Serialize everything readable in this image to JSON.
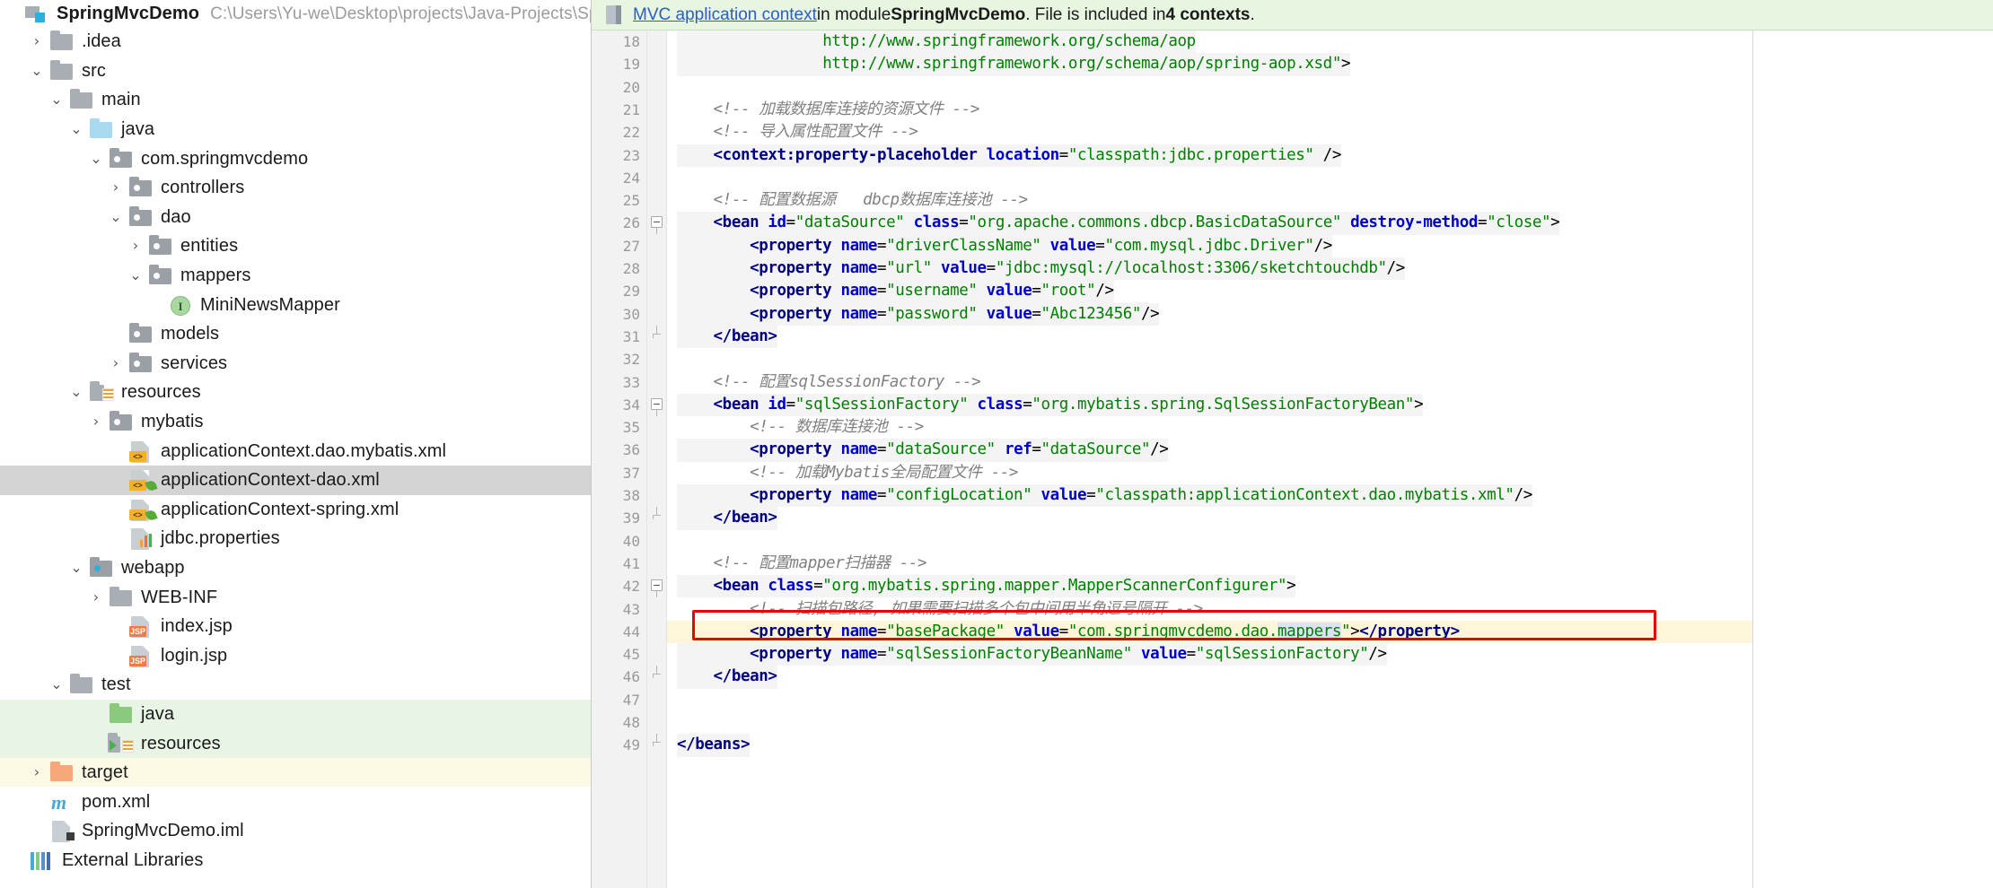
{
  "project": {
    "title": "SpringMvcDemo",
    "path": "C:\\Users\\Yu-we\\Desktop\\projects\\Java-Projects\\Sprin",
    "tree": [
      {
        "label": ".idea",
        "indent": 1,
        "arrow": "right",
        "icon": "folder-gray",
        "bg": ""
      },
      {
        "label": "src",
        "indent": 1,
        "arrow": "down",
        "icon": "folder-gray",
        "bg": ""
      },
      {
        "label": "main",
        "indent": 2,
        "arrow": "down",
        "icon": "folder-gray",
        "bg": ""
      },
      {
        "label": "java",
        "indent": 3,
        "arrow": "down",
        "icon": "folder-blue",
        "bg": ""
      },
      {
        "label": "com.springmvcdemo",
        "indent": 4,
        "arrow": "down",
        "icon": "package",
        "bg": ""
      },
      {
        "label": "controllers",
        "indent": 5,
        "arrow": "right",
        "icon": "package",
        "bg": ""
      },
      {
        "label": "dao",
        "indent": 5,
        "arrow": "down",
        "icon": "package",
        "bg": ""
      },
      {
        "label": "entities",
        "indent": 6,
        "arrow": "right",
        "icon": "package",
        "bg": ""
      },
      {
        "label": "mappers",
        "indent": 6,
        "arrow": "down",
        "icon": "package",
        "bg": ""
      },
      {
        "label": "MiniNewsMapper",
        "indent": 7,
        "arrow": "none",
        "icon": "interface",
        "bg": ""
      },
      {
        "label": "models",
        "indent": 5,
        "arrow": "none",
        "icon": "package",
        "bg": ""
      },
      {
        "label": "services",
        "indent": 5,
        "arrow": "right",
        "icon": "package",
        "bg": ""
      },
      {
        "label": "resources",
        "indent": 3,
        "arrow": "down",
        "icon": "resource",
        "bg": ""
      },
      {
        "label": "mybatis",
        "indent": 4,
        "arrow": "right",
        "icon": "package",
        "bg": ""
      },
      {
        "label": "applicationContext.dao.mybatis.xml",
        "indent": 5,
        "arrow": "none",
        "icon": "xml-file",
        "bg": ""
      },
      {
        "label": "applicationContext-dao.xml",
        "indent": 5,
        "arrow": "none",
        "icon": "xml-spring",
        "bg": "selected"
      },
      {
        "label": "applicationContext-spring.xml",
        "indent": 5,
        "arrow": "none",
        "icon": "xml-spring",
        "bg": ""
      },
      {
        "label": "jdbc.properties",
        "indent": 5,
        "arrow": "none",
        "icon": "properties",
        "bg": ""
      },
      {
        "label": "webapp",
        "indent": 3,
        "arrow": "down",
        "icon": "folder-web",
        "bg": ""
      },
      {
        "label": "WEB-INF",
        "indent": 4,
        "arrow": "right",
        "icon": "folder-gray",
        "bg": ""
      },
      {
        "label": "index.jsp",
        "indent": 5,
        "arrow": "none",
        "icon": "jsp-file",
        "bg": ""
      },
      {
        "label": "login.jsp",
        "indent": 5,
        "arrow": "none",
        "icon": "jsp-file",
        "bg": ""
      },
      {
        "label": "test",
        "indent": 2,
        "arrow": "down",
        "icon": "folder-gray",
        "bg": ""
      },
      {
        "label": "java",
        "indent": 4,
        "arrow": "none",
        "icon": "folder-green",
        "bg": "green"
      },
      {
        "label": "resources",
        "indent": 4,
        "arrow": "none",
        "icon": "test-resource",
        "bg": "green"
      },
      {
        "label": "target",
        "indent": 1,
        "arrow": "right",
        "icon": "folder-orange",
        "bg": "yellow"
      },
      {
        "label": "pom.xml",
        "indent": 1,
        "arrow": "none",
        "icon": "maven",
        "bg": ""
      },
      {
        "label": "SpringMvcDemo.iml",
        "indent": 1,
        "arrow": "none",
        "icon": "iml",
        "bg": ""
      },
      {
        "label": "External Libraries",
        "indent": 0,
        "arrow": "none",
        "icon": "libraries",
        "bg": ""
      }
    ]
  },
  "notification": {
    "icon": "spring-context-icon",
    "link_text": "MVC application context",
    "text_1": "in module ",
    "module": "SpringMvcDemo",
    "text_2": ". File is included in ",
    "contexts": "4 contexts",
    "text_3": ".",
    "background_color": "#e8f5e0"
  },
  "editor": {
    "first_visible_line": 18,
    "caret_line": 44,
    "highlight_color": "#fdf6d8",
    "red_box_color": "#ee0000",
    "lines": [
      {
        "n": 18,
        "partial": true,
        "segs": [
          {
            "t": "                ",
            "c": "plain"
          },
          {
            "t": "http://www.springframework.org/schema/aop",
            "c": "str"
          }
        ],
        "hl": true
      },
      {
        "n": 19,
        "segs": [
          {
            "t": "                ",
            "c": "plain"
          },
          {
            "t": "http://www.springframework.org/schema/aop/spring-aop.xsd",
            "c": "str"
          },
          {
            "t": "\"",
            "c": "str"
          },
          {
            "t": ">",
            "c": "brkt"
          }
        ],
        "hl": true
      },
      {
        "n": 20,
        "segs": []
      },
      {
        "n": 21,
        "segs": [
          {
            "t": "    <!-- 加载数据库连接的资源文件 -->",
            "c": "cmt"
          }
        ]
      },
      {
        "n": 22,
        "segs": [
          {
            "t": "    <!-- 导入属性配置文件 -->",
            "c": "cmt"
          }
        ]
      },
      {
        "n": 23,
        "hl": true,
        "segs": [
          {
            "t": "    ",
            "c": "plain"
          },
          {
            "t": "<context:property-placeholder",
            "c": "tag"
          },
          {
            "t": " ",
            "c": "plain"
          },
          {
            "t": "location",
            "c": "attr"
          },
          {
            "t": "=",
            "c": "brkt"
          },
          {
            "t": "\"classpath:jdbc.properties\"",
            "c": "str"
          },
          {
            "t": " />",
            "c": "brkt"
          }
        ]
      },
      {
        "n": 24,
        "segs": []
      },
      {
        "n": 25,
        "segs": [
          {
            "t": "    <!-- 配置数据源   dbcp数据库连接池 -->",
            "c": "cmt"
          }
        ]
      },
      {
        "n": 26,
        "fold": "open",
        "hl": true,
        "segs": [
          {
            "t": "    ",
            "c": "plain"
          },
          {
            "t": "<bean",
            "c": "tag"
          },
          {
            "t": " ",
            "c": "plain"
          },
          {
            "t": "id",
            "c": "attr"
          },
          {
            "t": "=",
            "c": "brkt"
          },
          {
            "t": "\"dataSource\"",
            "c": "str"
          },
          {
            "t": " ",
            "c": "plain"
          },
          {
            "t": "class",
            "c": "attr"
          },
          {
            "t": "=",
            "c": "brkt"
          },
          {
            "t": "\"org.apache.commons.dbcp.BasicDataSource\"",
            "c": "str"
          },
          {
            "t": " ",
            "c": "plain"
          },
          {
            "t": "destroy-method",
            "c": "attr"
          },
          {
            "t": "=",
            "c": "brkt"
          },
          {
            "t": "\"close\"",
            "c": "str"
          },
          {
            "t": ">",
            "c": "brkt"
          }
        ]
      },
      {
        "n": 27,
        "hl": true,
        "segs": [
          {
            "t": "        ",
            "c": "plain"
          },
          {
            "t": "<property",
            "c": "tag"
          },
          {
            "t": " ",
            "c": "plain"
          },
          {
            "t": "name",
            "c": "attr"
          },
          {
            "t": "=",
            "c": "brkt"
          },
          {
            "t": "\"driverClassName\"",
            "c": "str"
          },
          {
            "t": " ",
            "c": "plain"
          },
          {
            "t": "value",
            "c": "attr"
          },
          {
            "t": "=",
            "c": "brkt"
          },
          {
            "t": "\"com.mysql.jdbc.Driver\"",
            "c": "str"
          },
          {
            "t": "/>",
            "c": "brkt"
          }
        ]
      },
      {
        "n": 28,
        "hl": true,
        "segs": [
          {
            "t": "        ",
            "c": "plain"
          },
          {
            "t": "<property",
            "c": "tag"
          },
          {
            "t": " ",
            "c": "plain"
          },
          {
            "t": "name",
            "c": "attr"
          },
          {
            "t": "=",
            "c": "brkt"
          },
          {
            "t": "\"url\"",
            "c": "str"
          },
          {
            "t": " ",
            "c": "plain"
          },
          {
            "t": "value",
            "c": "attr"
          },
          {
            "t": "=",
            "c": "brkt"
          },
          {
            "t": "\"jdbc:mysql://localhost:3306/sketchtouchdb\"",
            "c": "str"
          },
          {
            "t": "/>",
            "c": "brkt"
          }
        ]
      },
      {
        "n": 29,
        "hl": true,
        "segs": [
          {
            "t": "        ",
            "c": "plain"
          },
          {
            "t": "<property",
            "c": "tag"
          },
          {
            "t": " ",
            "c": "plain"
          },
          {
            "t": "name",
            "c": "attr"
          },
          {
            "t": "=",
            "c": "brkt"
          },
          {
            "t": "\"username\"",
            "c": "str"
          },
          {
            "t": " ",
            "c": "plain"
          },
          {
            "t": "value",
            "c": "attr"
          },
          {
            "t": "=",
            "c": "brkt"
          },
          {
            "t": "\"root\"",
            "c": "str"
          },
          {
            "t": "/>",
            "c": "brkt"
          }
        ]
      },
      {
        "n": 30,
        "hl": true,
        "segs": [
          {
            "t": "        ",
            "c": "plain"
          },
          {
            "t": "<property",
            "c": "tag"
          },
          {
            "t": " ",
            "c": "plain"
          },
          {
            "t": "name",
            "c": "attr"
          },
          {
            "t": "=",
            "c": "brkt"
          },
          {
            "t": "\"password\"",
            "c": "str"
          },
          {
            "t": " ",
            "c": "plain"
          },
          {
            "t": "value",
            "c": "attr"
          },
          {
            "t": "=",
            "c": "brkt"
          },
          {
            "t": "\"Abc123456\"",
            "c": "str"
          },
          {
            "t": "/>",
            "c": "brkt"
          }
        ]
      },
      {
        "n": 31,
        "fold": "close",
        "hl": true,
        "segs": [
          {
            "t": "    ",
            "c": "plain"
          },
          {
            "t": "</bean>",
            "c": "tag"
          }
        ]
      },
      {
        "n": 32,
        "segs": []
      },
      {
        "n": 33,
        "segs": [
          {
            "t": "    <!-- 配置sqlSessionFactory -->",
            "c": "cmt"
          }
        ]
      },
      {
        "n": 34,
        "fold": "open",
        "hl": true,
        "segs": [
          {
            "t": "    ",
            "c": "plain"
          },
          {
            "t": "<bean",
            "c": "tag"
          },
          {
            "t": " ",
            "c": "plain"
          },
          {
            "t": "id",
            "c": "attr"
          },
          {
            "t": "=",
            "c": "brkt"
          },
          {
            "t": "\"sqlSessionFactory\"",
            "c": "str"
          },
          {
            "t": " ",
            "c": "plain"
          },
          {
            "t": "class",
            "c": "attr"
          },
          {
            "t": "=",
            "c": "brkt"
          },
          {
            "t": "\"org.mybatis.spring.SqlSessionFactoryBean\"",
            "c": "str"
          },
          {
            "t": ">",
            "c": "brkt"
          }
        ]
      },
      {
        "n": 35,
        "segs": [
          {
            "t": "        <!-- 数据库连接池 -->",
            "c": "cmt"
          }
        ]
      },
      {
        "n": 36,
        "hl": true,
        "segs": [
          {
            "t": "        ",
            "c": "plain"
          },
          {
            "t": "<property",
            "c": "tag"
          },
          {
            "t": " ",
            "c": "plain"
          },
          {
            "t": "name",
            "c": "attr"
          },
          {
            "t": "=",
            "c": "brkt"
          },
          {
            "t": "\"dataSource\"",
            "c": "str"
          },
          {
            "t": " ",
            "c": "plain"
          },
          {
            "t": "ref",
            "c": "attr"
          },
          {
            "t": "=",
            "c": "brkt"
          },
          {
            "t": "\"dataSource\"",
            "c": "str"
          },
          {
            "t": "/>",
            "c": "brkt"
          }
        ]
      },
      {
        "n": 37,
        "segs": [
          {
            "t": "        <!-- 加载Mybatis全局配置文件 -->",
            "c": "cmt"
          }
        ]
      },
      {
        "n": 38,
        "hl": true,
        "segs": [
          {
            "t": "        ",
            "c": "plain"
          },
          {
            "t": "<property",
            "c": "tag"
          },
          {
            "t": " ",
            "c": "plain"
          },
          {
            "t": "name",
            "c": "attr"
          },
          {
            "t": "=",
            "c": "brkt"
          },
          {
            "t": "\"configLocation\"",
            "c": "str"
          },
          {
            "t": " ",
            "c": "plain"
          },
          {
            "t": "value",
            "c": "attr"
          },
          {
            "t": "=",
            "c": "brkt"
          },
          {
            "t": "\"classpath:applicationContext.dao.mybatis.xml\"",
            "c": "str"
          },
          {
            "t": "/>",
            "c": "brkt"
          }
        ]
      },
      {
        "n": 39,
        "fold": "close",
        "hl": true,
        "segs": [
          {
            "t": "    ",
            "c": "plain"
          },
          {
            "t": "</bean>",
            "c": "tag"
          }
        ]
      },
      {
        "n": 40,
        "segs": []
      },
      {
        "n": 41,
        "segs": [
          {
            "t": "    <!-- 配置mapper扫描器 -->",
            "c": "cmt"
          }
        ]
      },
      {
        "n": 42,
        "fold": "open",
        "hl": true,
        "segs": [
          {
            "t": "    ",
            "c": "plain"
          },
          {
            "t": "<bean",
            "c": "tag"
          },
          {
            "t": " ",
            "c": "plain"
          },
          {
            "t": "class",
            "c": "attr"
          },
          {
            "t": "=",
            "c": "brkt"
          },
          {
            "t": "\"org.mybatis.spring.mapper.MapperScannerConfigurer\"",
            "c": "str"
          },
          {
            "t": ">",
            "c": "brkt"
          }
        ]
      },
      {
        "n": 43,
        "segs": [
          {
            "t": "        <!-- 扫描包路径, 如果需要扫描多个包中间用半角逗号隔开 -->",
            "c": "cmt"
          }
        ]
      },
      {
        "n": 44,
        "caret": true,
        "segs": [
          {
            "t": "        ",
            "c": "plain"
          },
          {
            "t": "<property",
            "c": "tag"
          },
          {
            "t": " ",
            "c": "plain"
          },
          {
            "t": "name",
            "c": "attr"
          },
          {
            "t": "=",
            "c": "brkt"
          },
          {
            "t": "\"basePackage\"",
            "c": "str"
          },
          {
            "t": " ",
            "c": "plain"
          },
          {
            "t": "value",
            "c": "attr"
          },
          {
            "t": "=",
            "c": "brkt"
          },
          {
            "t": "\"com.springmvcdemo.dao.",
            "c": "str"
          },
          {
            "t": "mappers",
            "c": "str sel-word"
          },
          {
            "t": "\"",
            "c": "str"
          },
          {
            "t": ">",
            "c": "brkt"
          },
          {
            "t": "</property>",
            "c": "tag"
          }
        ]
      },
      {
        "n": 45,
        "hl": true,
        "segs": [
          {
            "t": "        ",
            "c": "plain"
          },
          {
            "t": "<property",
            "c": "tag"
          },
          {
            "t": " ",
            "c": "plain"
          },
          {
            "t": "name",
            "c": "attr"
          },
          {
            "t": "=",
            "c": "brkt"
          },
          {
            "t": "\"sqlSessionFactoryBeanName\"",
            "c": "str"
          },
          {
            "t": " ",
            "c": "plain"
          },
          {
            "t": "value",
            "c": "attr"
          },
          {
            "t": "=",
            "c": "brkt"
          },
          {
            "t": "\"sqlSessionFactory\"",
            "c": "str"
          },
          {
            "t": "/>",
            "c": "brkt"
          }
        ]
      },
      {
        "n": 46,
        "fold": "close",
        "hl": true,
        "segs": [
          {
            "t": "    ",
            "c": "plain"
          },
          {
            "t": "</bean>",
            "c": "tag"
          }
        ]
      },
      {
        "n": 47,
        "segs": []
      },
      {
        "n": 48,
        "segs": []
      },
      {
        "n": 49,
        "fold": "endtail",
        "hl": true,
        "segs": [
          {
            "t": "</beans>",
            "c": "tag"
          }
        ]
      }
    ]
  }
}
